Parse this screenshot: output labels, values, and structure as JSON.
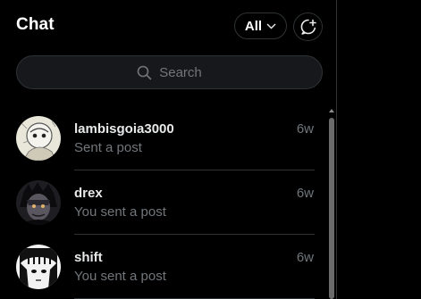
{
  "header": {
    "title": "Chat",
    "filter_label": "All",
    "filter_icon": "chevron-down-icon",
    "compose_icon": "new-message-icon"
  },
  "search": {
    "placeholder": "Search",
    "icon": "search-icon"
  },
  "conversations": [
    {
      "name": "lambisgoia3000",
      "preview": "Sent a post",
      "time": "6w"
    },
    {
      "name": "drex",
      "preview": "You sent a post",
      "time": "6w"
    },
    {
      "name": "shift",
      "preview": "You sent a post",
      "time": "6w"
    }
  ],
  "colors": {
    "background": "#000000",
    "border": "#2f3336",
    "muted_text": "#71767b",
    "primary_text": "#e7e9ea"
  }
}
